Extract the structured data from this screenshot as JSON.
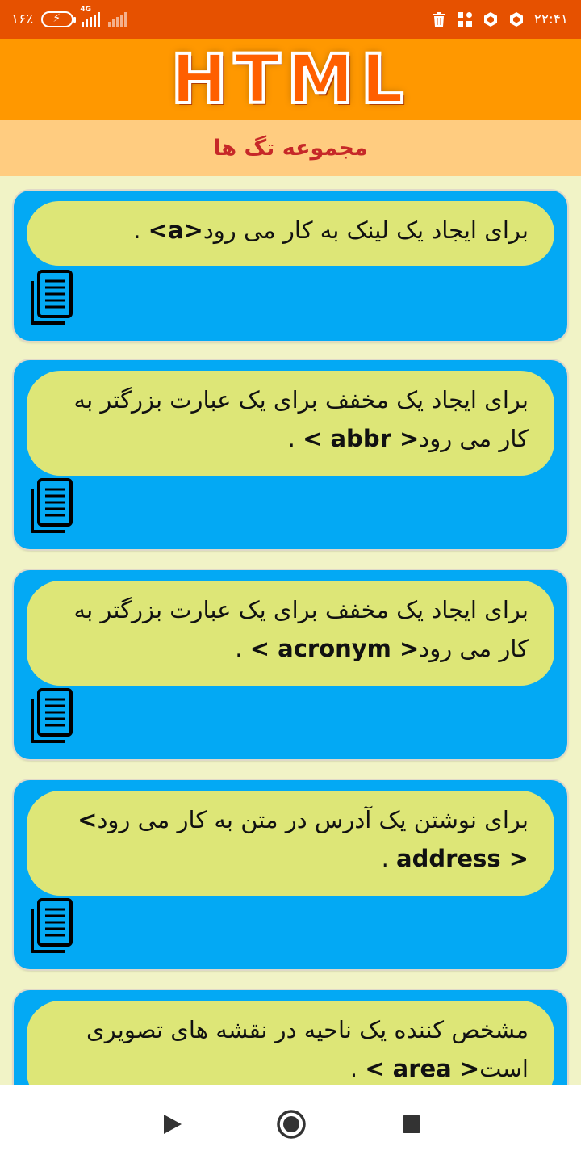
{
  "status_bar": {
    "battery_percent": "۱۶٪",
    "network_type": "4G",
    "time": "۲۲:۴۱"
  },
  "header": {
    "title": "HTML"
  },
  "subheader": {
    "title": "مجموعه تگ ها"
  },
  "items": [
    {
      "description": "برای ایجاد یک لینک به کار می رود",
      "tag": "<a>",
      "suffix": "."
    },
    {
      "description": "برای ایجاد یک مخفف برای یک عبارت بزرگتر به کار می رود",
      "tag": "< abbr >",
      "suffix": "."
    },
    {
      "description": "برای ایجاد یک مخفف برای یک عبارت بزرگتر به کار می رود",
      "tag": "< acronym >",
      "suffix": "."
    },
    {
      "description": "برای نوشتن یک آدرس در متن به کار می رود",
      "tag": "< address >",
      "suffix": "."
    },
    {
      "description": "مشخص کننده یک ناحیه در نقشه های تصویری است",
      "tag": "< area >",
      "suffix": "."
    }
  ],
  "icons": {
    "copy": "copy-document-icon",
    "back": "back-triangle-icon",
    "home": "home-circle-icon",
    "recents": "recents-square-icon"
  },
  "colors": {
    "status_bar": "#e65100",
    "header": "#ff9800",
    "subheader": "#ffcc80",
    "subheader_text": "#c62828",
    "card": "#03a9f4",
    "pill": "#dde677",
    "background": "#f1f3c6"
  }
}
